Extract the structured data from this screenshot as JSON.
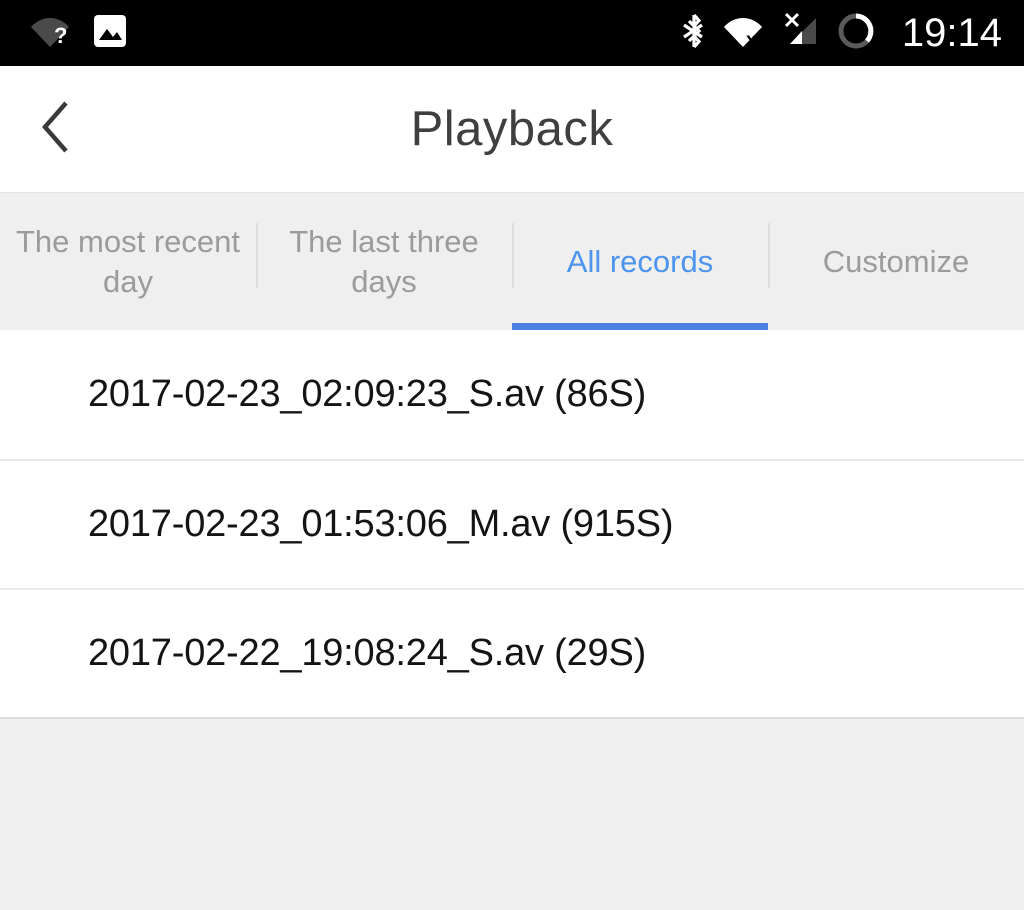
{
  "status_bar": {
    "left_icons": [
      {
        "name": "wifi-unknown-icon",
        "label": "WiFi no internet"
      },
      {
        "name": "screenshot-image-icon",
        "label": "Screenshot saved"
      }
    ],
    "right_icons": [
      {
        "name": "bluetooth-icon",
        "label": "Bluetooth on"
      },
      {
        "name": "wifi-disconnected-icon",
        "label": "WiFi disconnected"
      },
      {
        "name": "cellular-signal-x-icon",
        "label": "No cellular service"
      },
      {
        "name": "battery-circle-icon",
        "label": "Battery"
      }
    ],
    "clock": "19:14"
  },
  "app_bar": {
    "back_icon": "chevron-left-icon",
    "title": "Playback"
  },
  "tabs": [
    {
      "label": "The most recent day",
      "active": false
    },
    {
      "label": "The last three days",
      "active": false
    },
    {
      "label": "All records",
      "active": true
    },
    {
      "label": "Customize",
      "active": false
    }
  ],
  "records": [
    {
      "name": "2017-02-23_02:09:23_S.av (86S)"
    },
    {
      "name": "2017-02-23_01:53:06_M.av (915S)"
    },
    {
      "name": "2017-02-22_19:08:24_S.av (29S)"
    }
  ],
  "colors": {
    "accent_text": "#4d94ee",
    "accent_underline": "#4a7fe0",
    "tab_inactive_text": "#9b9b9b",
    "title_text": "#3f3f3f",
    "record_text": "#141414",
    "page_background": "#efefef",
    "status_bar_background": "#000000"
  }
}
